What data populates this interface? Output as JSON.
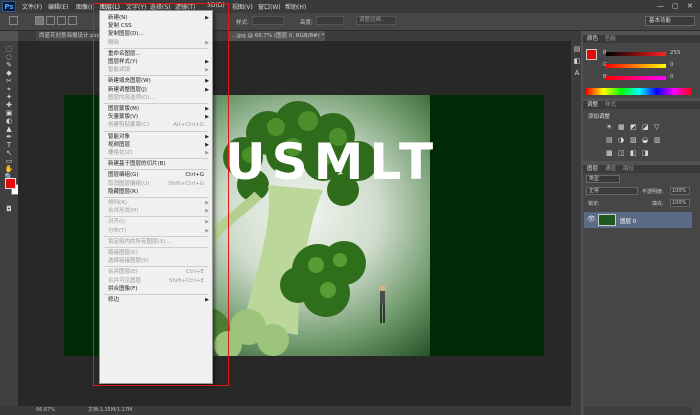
{
  "app": {
    "logo": "Ps"
  },
  "menubar": {
    "items": [
      "文件(F)",
      "编辑(E)",
      "图像(I)",
      "图层(L)",
      "文字(Y)",
      "选择(S)",
      "滤镜(T)",
      "3D(D)",
      "视图(V)",
      "窗口(W)",
      "帮助(H)"
    ],
    "window_buttons": [
      "—",
      "▢",
      "✕"
    ]
  },
  "options": {
    "feather_label": "羽化:",
    "feather_value": "0 像素",
    "style_label": "样式:",
    "width_label": "宽度:",
    "height_label": "高度:",
    "refine_label": "调整边缘...",
    "workspace": "基本功能"
  },
  "tabs": [
    {
      "label": "西蓝花创意海报设计.psd"
    },
    {
      "label": "...jpg @ 66.7% (图层 0, RGB/8#) *"
    }
  ],
  "canvas": {
    "headline": "USMLT"
  },
  "status": {
    "zoom": "66.67%",
    "doc": "文档:1.35M/1.17M"
  },
  "color_panel": {
    "tabs": [
      "颜色",
      "色板"
    ],
    "channels": [
      {
        "label": "R",
        "value": "255",
        "color": "#ff2020"
      },
      {
        "label": "G",
        "value": "0",
        "color": "#2aff2a"
      },
      {
        "label": "B",
        "value": "0",
        "color": "#3a6cff"
      }
    ],
    "foreground": "#e10b0b",
    "background": "#ffffff"
  },
  "adjust_panel": {
    "tabs": [
      "调整",
      "样式"
    ],
    "add_label": "添加调整"
  },
  "layers_panel": {
    "tabs": [
      "图层",
      "通道",
      "路径"
    ],
    "kind": "类型",
    "blend_mode": "正常",
    "opacity_label": "不透明度:",
    "opacity": "100%",
    "lock_label": "锁定:",
    "fill_label": "填充:",
    "fill": "100%",
    "layer_name": "图层 0"
  },
  "layer_menu": {
    "items": [
      {
        "label": "新建(N)",
        "sub": true
      },
      {
        "label": "复制 CSS"
      },
      {
        "label": "复制图层(D)..."
      },
      {
        "label": "删除",
        "sub": true,
        "disabled": true
      },
      {
        "sep": true
      },
      {
        "label": "重命名图层..."
      },
      {
        "label": "图层样式(Y)",
        "sub": true
      },
      {
        "label": "智能滤镜",
        "sub": true,
        "disabled": true
      },
      {
        "sep": true
      },
      {
        "label": "新建填充图层(W)",
        "sub": true
      },
      {
        "label": "新建调整图层(J)",
        "sub": true
      },
      {
        "label": "图层内容选项(O)...",
        "disabled": true
      },
      {
        "sep": true
      },
      {
        "label": "图层蒙版(M)",
        "sub": true
      },
      {
        "label": "矢量蒙版(V)",
        "sub": true
      },
      {
        "label": "创建剪贴蒙版(C)",
        "shortcut": "Alt+Ctrl+G",
        "disabled": true
      },
      {
        "sep": true
      },
      {
        "label": "智能对象",
        "sub": true
      },
      {
        "label": "视频图层",
        "sub": true
      },
      {
        "label": "栅格化(Z)",
        "sub": true,
        "disabled": true
      },
      {
        "sep": true
      },
      {
        "label": "新建基于图层的切片(B)"
      },
      {
        "sep": true
      },
      {
        "label": "图层编组(G)",
        "shortcut": "Ctrl+G"
      },
      {
        "label": "取消图层编组(U)",
        "shortcut": "Shift+Ctrl+G",
        "disabled": true
      },
      {
        "label": "隐藏图层(R)"
      },
      {
        "sep": true
      },
      {
        "label": "排列(A)",
        "sub": true,
        "disabled": true
      },
      {
        "label": "合并形状(H)",
        "sub": true,
        "disabled": true
      },
      {
        "sep": true
      },
      {
        "label": "对齐(I)",
        "sub": true,
        "disabled": true
      },
      {
        "label": "分布(T)",
        "sub": true,
        "disabled": true
      },
      {
        "sep": true
      },
      {
        "label": "锁定组内的所有图层(X)...",
        "disabled": true
      },
      {
        "sep": true
      },
      {
        "label": "链接图层(K)",
        "disabled": true
      },
      {
        "label": "选择链接图层(S)",
        "disabled": true
      },
      {
        "sep": true
      },
      {
        "label": "合并图层(E)",
        "shortcut": "Ctrl+E",
        "disabled": true
      },
      {
        "label": "合并可见图层",
        "shortcut": "Shift+Ctrl+E",
        "disabled": true
      },
      {
        "label": "拼合图像(F)"
      },
      {
        "sep": true
      },
      {
        "label": "修边",
        "sub": true
      }
    ]
  }
}
